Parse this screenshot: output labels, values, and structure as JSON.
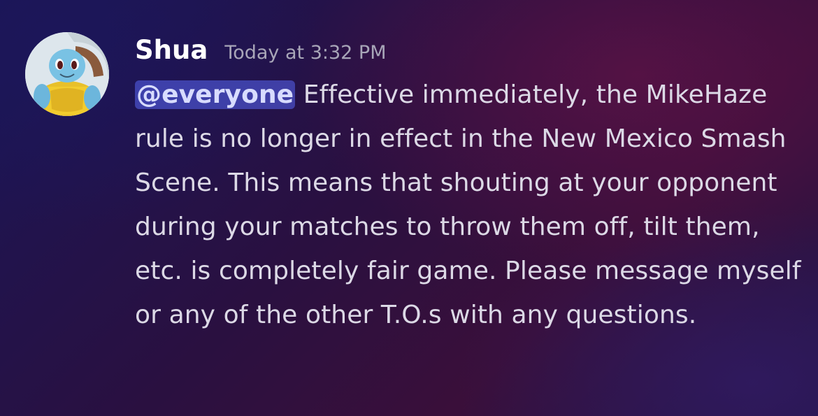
{
  "message": {
    "author": "Shua",
    "timestamp": "Today at 3:32 PM",
    "mention": "@everyone",
    "body": " Effective immediately, the MikeHaze rule is no longer in effect in the New Mexico Smash Scene. This means that shouting at your opponent during your matches to throw them off, tilt them, etc. is completely fair game. Please message myself or any of the other T.O.s with any questions.",
    "avatar": "squirtle-muscle-avatar"
  },
  "colors": {
    "username": "#ffffff",
    "timestamp": "#a8a6b8",
    "body_text": "#dcd9e6",
    "mention_bg": "#5865f2"
  }
}
